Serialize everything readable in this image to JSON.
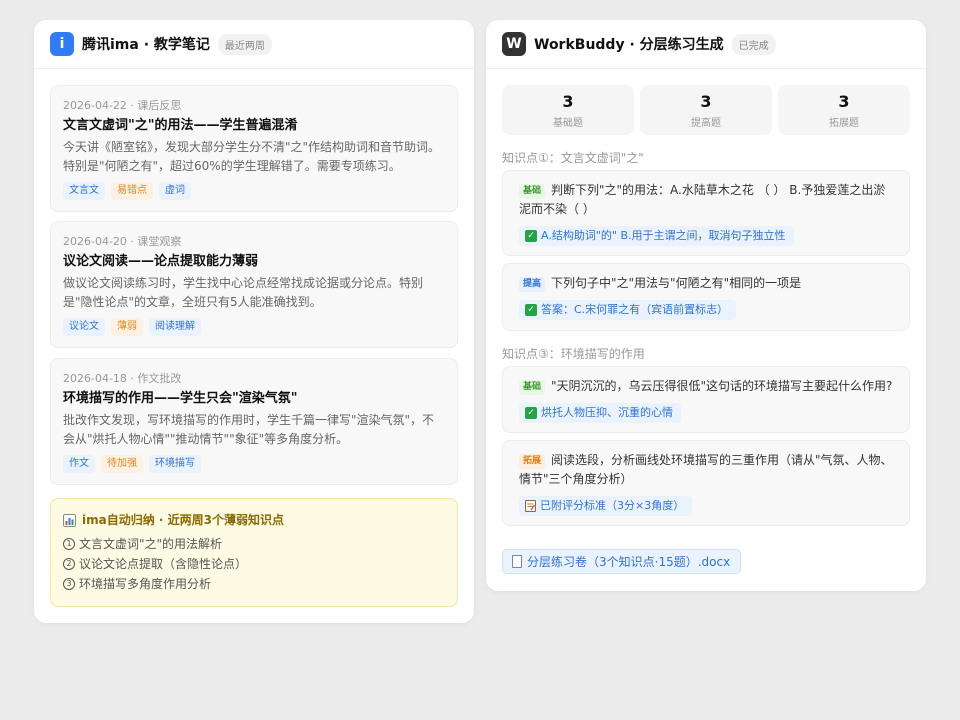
{
  "colors": {
    "ima_brand": "#2f7cf6",
    "workbuddy_brand": "#333333",
    "tag_blue": "#2f73d8",
    "tag_orange": "#e08a1e",
    "summary_bg": "#fdfbe3",
    "check_green": "#22a447"
  },
  "left": {
    "app_icon_text": "i",
    "title": "腾讯ima · 教学笔记",
    "badge": "最近两周",
    "notes": [
      {
        "meta": "2026-04-22 · 课后反思",
        "title": "文言文虚词\"之\"的用法——学生普遍混淆",
        "body": "今天讲《陋室铭》，发现大部分学生分不清\"之\"作结构助词和音节助词。特别是\"何陋之有\"，超过60%的学生理解错了。需要专项练习。",
        "tags": [
          {
            "label": "文言文",
            "color": "blue"
          },
          {
            "label": "易错点",
            "color": "orange"
          },
          {
            "label": "虚词",
            "color": "blue"
          }
        ]
      },
      {
        "meta": "2026-04-20 · 课堂观察",
        "title": "议论文阅读——论点提取能力薄弱",
        "body": "做议论文阅读练习时，学生找中心论点经常找成论据或分论点。特别是\"隐性论点\"的文章，全班只有5人能准确找到。",
        "tags": [
          {
            "label": "议论文",
            "color": "blue"
          },
          {
            "label": "薄弱",
            "color": "orange"
          },
          {
            "label": "阅读理解",
            "color": "blue"
          }
        ]
      },
      {
        "meta": "2026-04-18 · 作文批改",
        "title": "环境描写的作用——学生只会\"渲染气氛\"",
        "body": "批改作文发现，写环境描写的作用时，学生千篇一律写\"渲染气氛\"，不会从\"烘托人物心情\"\"推动情节\"\"象征\"等多角度分析。",
        "tags": [
          {
            "label": "作文",
            "color": "blue"
          },
          {
            "label": "待加强",
            "color": "orange"
          },
          {
            "label": "环境描写",
            "color": "blue"
          }
        ]
      }
    ],
    "summary": {
      "icon": "bar-chart-icon",
      "title": "ima自动归纳 · 近两周3个薄弱知识点",
      "items": [
        {
          "num": "1",
          "text": "文言文虚词\"之\"的用法解析"
        },
        {
          "num": "2",
          "text": "议论文论点提取（含隐性论点）"
        },
        {
          "num": "3",
          "text": "环境描写多角度作用分析"
        }
      ]
    }
  },
  "right": {
    "app_icon_text": "W",
    "title": "WorkBuddy · 分层练习生成",
    "badge": "已完成",
    "stats": [
      {
        "num": "3",
        "label": "基础题"
      },
      {
        "num": "3",
        "label": "提高题"
      },
      {
        "num": "3",
        "label": "拓展题"
      }
    ],
    "kp1_label": "知识点①：文言文虚词\"之\"",
    "kp3_label": "知识点③：环境描写的作用",
    "questions": [
      {
        "level": "基础",
        "level_type": "basic",
        "text": "判断下列\"之\"的用法：A.水陆草木之花 （ ） B.予独爱莲之出淤泥而不染（ ）",
        "answer": "A.结构助词\"的\" B.用于主谓之间，取消句子独立性",
        "answer_icon": "check-icon"
      },
      {
        "level": "提高",
        "level_type": "improve",
        "text": "下列句子中\"之\"用法与\"何陋之有\"相同的一项是",
        "answer": "答案：C.宋何罪之有（宾语前置标志）",
        "answer_icon": "check-icon"
      },
      {
        "level": "基础",
        "level_type": "basic",
        "text": "\"天阴沉沉的，乌云压得很低\"这句话的环境描写主要起什么作用?",
        "answer": "烘托人物压抑、沉重的心情",
        "answer_icon": "check-icon"
      },
      {
        "level": "拓展",
        "level_type": "expand",
        "text": "阅读选段，分析画线处环境描写的三重作用（请从\"气氛、人物、情节\"三个角度分析）",
        "answer": "已附评分标准（3分×3角度）",
        "answer_icon": "memo-icon"
      }
    ],
    "file": {
      "icon": "document-icon",
      "label": "分层练习卷（3个知识点·15题）.docx"
    }
  }
}
